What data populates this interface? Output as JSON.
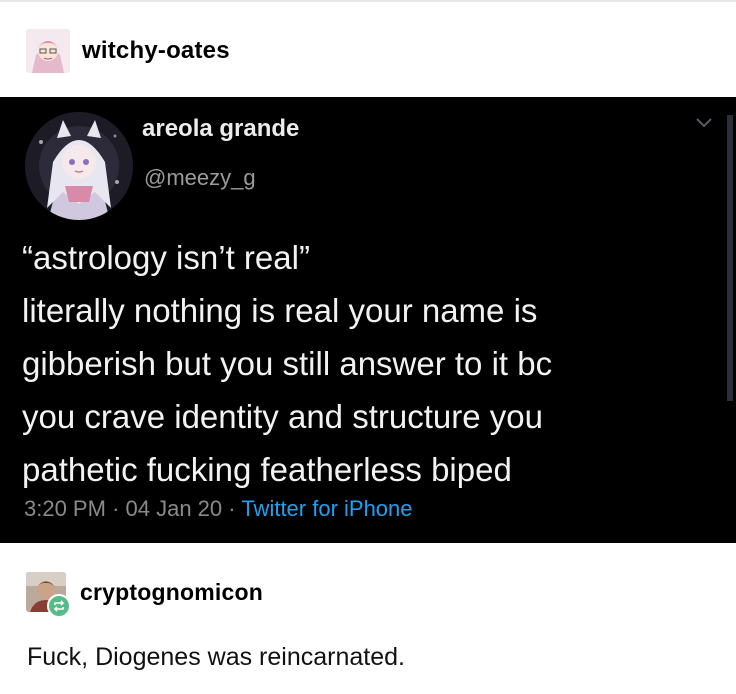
{
  "posts": [
    {
      "username": "witchy-oates",
      "avatar_icon": "anime-girl-avatar-icon"
    }
  ],
  "tweet": {
    "display_name": "areola grande",
    "handle": "@meezy_g",
    "lines": [
      "“astrology isn’t real”",
      "literally nothing is real your name is",
      "gibberish but you still answer to it bc",
      "you crave identity and structure you",
      "pathetic fucking featherless biped"
    ],
    "time": "3:20 PM",
    "date": "04 Jan 20",
    "separator": "·",
    "source": "Twitter for iPhone",
    "source_color": "#1da1f2",
    "background": "#000000"
  },
  "reblog": {
    "username": "cryptognomicon",
    "badge_icon": "reblog-icon",
    "badge_color": "#56bc8a",
    "comment": "Fuck, Diogenes was reincarnated."
  }
}
